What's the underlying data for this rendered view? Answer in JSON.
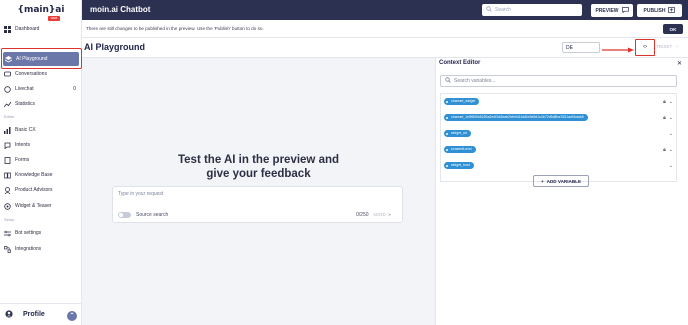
{
  "app": {
    "title": "moin.ai Chatbot"
  },
  "logo": {
    "text": "{main}ai",
    "tag": "WEB"
  },
  "topbar": {
    "search_placeholder": "Search",
    "preview_label": "PREVIEW",
    "publish_label": "PUBLISH"
  },
  "notice": {
    "text": "There are still changes to be published in the preview. Use the 'Publish' button to do so.",
    "ok_label": "OK"
  },
  "sidebar": {
    "items": [
      {
        "label": "Dashboard",
        "icon": "dashboard-icon"
      },
      {
        "label": "AI Playground",
        "icon": "playground-icon",
        "active": true
      },
      {
        "label": "Conversations",
        "icon": "conversations-icon"
      },
      {
        "label": "Livechat",
        "icon": "livechat-icon",
        "badge": "0"
      },
      {
        "label": "Statistics",
        "icon": "statistics-icon"
      },
      {
        "label": "Basic CX",
        "icon": "basic-cx-icon"
      },
      {
        "label": "Intents",
        "icon": "intents-icon"
      },
      {
        "label": "Forms",
        "icon": "forms-icon"
      },
      {
        "label": "Knowledge Base",
        "icon": "knowledge-base-icon"
      },
      {
        "label": "Product Advisors",
        "icon": "product-advisors-icon"
      },
      {
        "label": "Widget & Teaser",
        "icon": "widget-icon"
      },
      {
        "label": "Bot settings",
        "icon": "bot-settings-icon"
      },
      {
        "label": "Integrations",
        "icon": "integrations-icon"
      }
    ],
    "section_editor": "Editor",
    "section_setup": "Setup",
    "profile_label": "Profile"
  },
  "header": {
    "title": "AI Playground",
    "language": "DE",
    "reset_label": "RESET"
  },
  "main": {
    "heading_line1": "Test the AI in the preview and",
    "heading_line2": "give your feedback",
    "input_placeholder": "Type in your request",
    "source_search_label": "Source search",
    "char_count": "0/250",
    "send_label": "SEND"
  },
  "context_editor": {
    "title": "Context Editor",
    "search_placeholder": "Search variables...",
    "variables": [
      {
        "name": "channel_widget",
        "locked": true
      },
      {
        "name": "channel_1e5f890b5250a2e4f2d6bab2bfe9d1fdd2e5d5d1c4b72d5d8ba7831ad0bdab5",
        "locked": true
      },
      {
        "name": "widget_url",
        "locked": false
      },
      {
        "name": "consentLevel",
        "locked": true
      },
      {
        "name": "widget_host",
        "locked": false
      }
    ],
    "add_label": "ADD VARIABLE"
  },
  "colors": {
    "topbar": "#2c3051",
    "active_nav": "#6b77a8",
    "chip": "#2f90d4",
    "highlight": "#e0322c"
  }
}
